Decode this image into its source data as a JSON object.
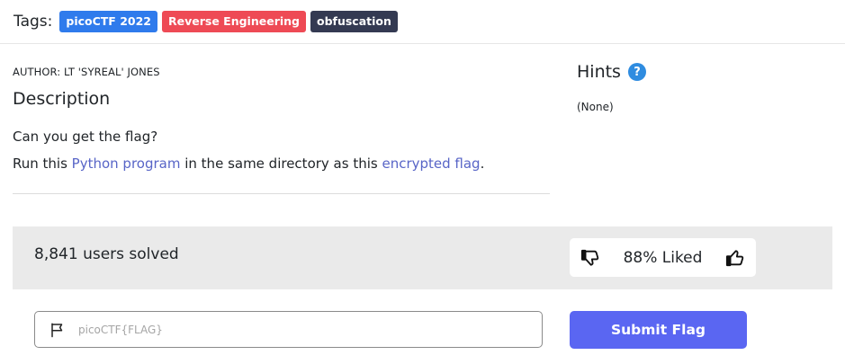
{
  "tags": {
    "label": "Tags:",
    "items": [
      "picoCTF 2022",
      "Reverse Engineering",
      "obfuscation"
    ],
    "colors": [
      "#2f7bec",
      "#ee4a55",
      "#343a52"
    ]
  },
  "challenge": {
    "author": "AUTHOR: LT 'SYREAL' JONES",
    "description_title": "Description",
    "line1": "Can you get the flag?",
    "line2_prefix": "Run this ",
    "line2_link1": "Python program",
    "line2_middle": " in the same directory as this ",
    "line2_link2": "encrypted flag",
    "line2_suffix": "."
  },
  "hints": {
    "title": "Hints",
    "help_icon_text": "?",
    "value": "(None)"
  },
  "stats": {
    "solved": "8,841 users solved",
    "liked": "88% Liked"
  },
  "flag_form": {
    "placeholder": "picoCTF{FLAG}",
    "submit_label": "Submit Flag"
  },
  "colors": {
    "link": "#5865c7",
    "accent_button": "#5a66f2",
    "help_icon": "#2f8ce0",
    "stats_band": "#eaeaea"
  },
  "icons": {
    "flag": "flag-icon",
    "dislike": "thumbs-down-icon",
    "like": "thumbs-up-icon",
    "help": "question-circle-icon"
  }
}
